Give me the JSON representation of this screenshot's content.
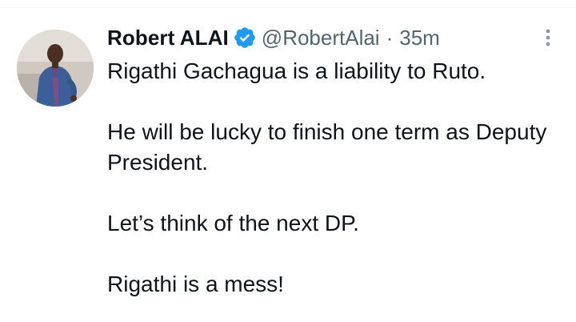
{
  "tweet": {
    "author": {
      "display_name": "Robert ALAI",
      "handle": "@RobertAlai",
      "verified": true,
      "avatar": "avatar-photo"
    },
    "separator": "·",
    "timestamp": "35m",
    "more_icon": "more-vertical-icon",
    "paragraphs": [
      "Rigathi Gachagua is a liability to Ruto.",
      "He will be lucky to finish one term as Deputy President.",
      "Let’s think of the next DP.",
      "Rigathi is a mess!"
    ]
  },
  "colors": {
    "verified_badge": "#1d9bf0",
    "secondary_text": "#536471",
    "primary_text": "#0f1419"
  }
}
